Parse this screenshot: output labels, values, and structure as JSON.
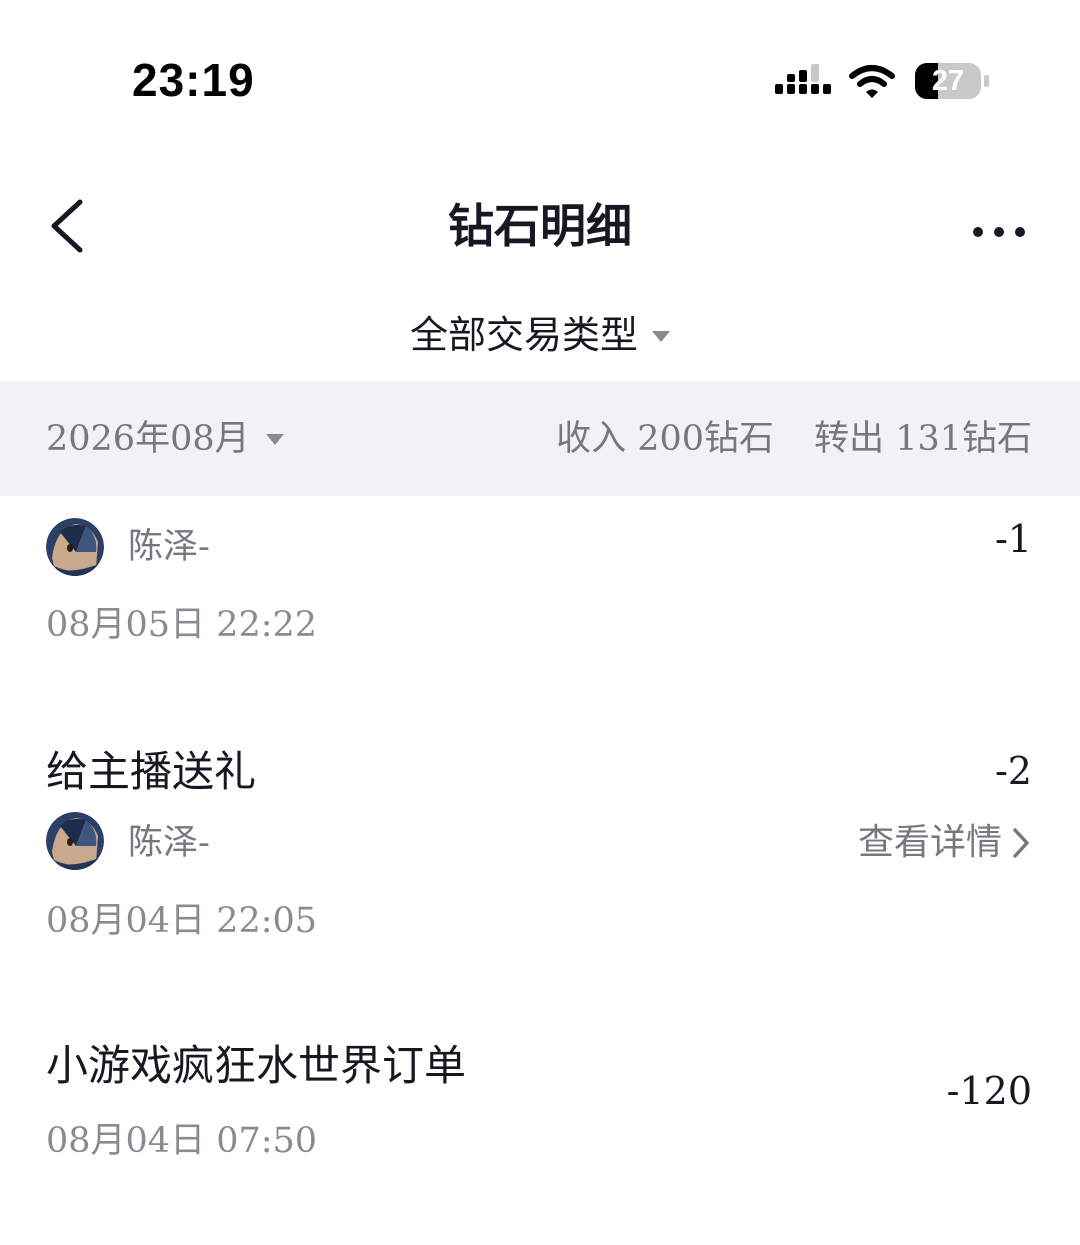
{
  "status_bar": {
    "time": "23:19",
    "battery_level": "27"
  },
  "nav": {
    "title": "钻石明细",
    "back_icon": "chevron-left-icon",
    "more_icon": "more-dots-icon"
  },
  "filter": {
    "label": "全部交易类型"
  },
  "summary": {
    "month": "2026年08月",
    "income": "收入 200钻石",
    "outgoing": "转出 131钻石"
  },
  "transactions": [
    {
      "user": "陈泽-",
      "time": "08月05日 22:22",
      "amount": "-1"
    },
    {
      "title": "给主播送礼",
      "user": "陈泽-",
      "time": "08月04日 22:05",
      "amount": "-2",
      "detail_link": "查看详情"
    },
    {
      "title": "小游戏疯狂水世界订单",
      "time": "08月04日 07:50",
      "amount": "-120"
    }
  ],
  "colors": {
    "primary_text": "#161823",
    "secondary_text": "#77787e",
    "band_background": "#f2f2f4"
  }
}
